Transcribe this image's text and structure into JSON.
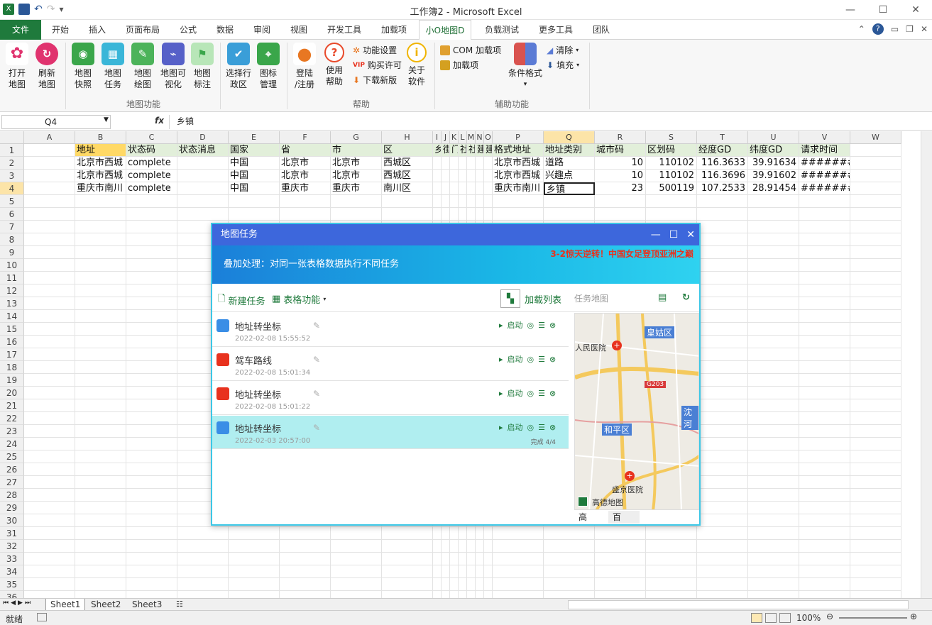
{
  "window": {
    "title": "工作簿2 - Microsoft Excel"
  },
  "ribbon_tabs": [
    {
      "label": "文件"
    },
    {
      "label": "开始"
    },
    {
      "label": "插入"
    },
    {
      "label": "页面布局"
    },
    {
      "label": "公式"
    },
    {
      "label": "数据"
    },
    {
      "label": "审阅"
    },
    {
      "label": "视图"
    },
    {
      "label": "开发工具"
    },
    {
      "label": "加载项"
    },
    {
      "label": "小O地图D"
    },
    {
      "label": "负载测试"
    },
    {
      "label": "更多工具"
    },
    {
      "label": "团队"
    }
  ],
  "ribbon": {
    "map_group": {
      "buttons": [
        {
          "label": "打开\n地图"
        },
        {
          "label": "刷新\n地图"
        },
        {
          "label": "地图\n快照"
        },
        {
          "label": "地图\n任务"
        },
        {
          "label": "地图\n绘图"
        },
        {
          "label": "地图可\n视化"
        },
        {
          "label": "地图\n标注"
        },
        {
          "label": "选择行\n政区"
        },
        {
          "label": "图标\n管理"
        }
      ],
      "name": "地图功能"
    },
    "help_group": {
      "buttons": [
        {
          "label": "登陆\n/注册"
        },
        {
          "label": "使用\n帮助"
        },
        {
          "label": "关于\n软件"
        }
      ],
      "small": [
        {
          "label": "功能设置"
        },
        {
          "label": "购买许可"
        },
        {
          "label": "下载新版"
        }
      ],
      "vip": "VIP",
      "name": "帮助"
    },
    "aux_group": {
      "com": "COM 加载项",
      "addin": "加载项",
      "cond": "条件格式",
      "clear": "清除",
      "fill": "填充",
      "name": "辅助功能"
    }
  },
  "formula_bar": {
    "name_box": "Q4",
    "fx": "fx",
    "value": "乡镇"
  },
  "columns": [
    "A",
    "B",
    "C",
    "D",
    "E",
    "F",
    "G",
    "H",
    "I",
    "J",
    "K",
    "L",
    "M",
    "N",
    "O",
    "P",
    "Q",
    "R",
    "S",
    "T",
    "U",
    "V",
    "W"
  ],
  "rows": [
    "1",
    "2",
    "3",
    "4",
    "5",
    "6",
    "7",
    "8",
    "9",
    "10",
    "11",
    "12",
    "13",
    "14",
    "15",
    "16",
    "17",
    "18",
    "19",
    "20",
    "21",
    "22",
    "23",
    "24",
    "25",
    "26",
    "27",
    "28",
    "29",
    "30",
    "31",
    "32",
    "33",
    "34",
    "35",
    "36"
  ],
  "cells": {
    "r1": {
      "B": "地址",
      "C": "状态码",
      "D": "状态消息",
      "E": "国家",
      "F": "省",
      "G": "市",
      "H": "区",
      "I": "乡",
      "J": "街",
      "K": "门",
      "L": "社",
      "M": "社",
      "N": "建",
      "O": "建",
      "P": "格式地址",
      "Q": "地址类别",
      "R": "城市码",
      "S": "区划码",
      "T": "经度GD",
      "U": "纬度GD",
      "V": "请求时间"
    },
    "r2": {
      "B": "北京市西城",
      "C": "complete",
      "E": "中国",
      "F": "北京市",
      "G": "北京市",
      "H": "西城区",
      "P": "北京市西城",
      "Q": "道路",
      "R": "10",
      "S": "110102",
      "T": "116.3633",
      "U": "39.91634",
      "V": "########"
    },
    "r3": {
      "B": "北京市西城",
      "C": "complete",
      "E": "中国",
      "F": "北京市",
      "G": "北京市",
      "H": "西城区",
      "P": "北京市西城",
      "Q": "兴趣点",
      "R": "10",
      "S": "110102",
      "T": "116.3696",
      "U": "39.91602",
      "V": "########"
    },
    "r4": {
      "B": "重庆市南川",
      "C": "complete",
      "E": "中国",
      "F": "重庆市",
      "G": "重庆市",
      "H": "南川区",
      "P": "重庆市南川",
      "Q": "乡镇",
      "R": "23",
      "S": "500119",
      "T": "107.2533",
      "U": "28.91454",
      "V": "########"
    }
  },
  "sheets": [
    {
      "label": "Sheet1"
    },
    {
      "label": "Sheet2"
    },
    {
      "label": "Sheet3"
    }
  ],
  "status": {
    "ready": "就绪",
    "zoom": "100%"
  },
  "dialog": {
    "title": "地图任务",
    "banner_text": "叠加处理：对同一张表格数据执行不同任务",
    "banner_news": "3-2惊天逆转！中国女足登顶亚洲之巅",
    "new_task": "新建任务",
    "table_func": "表格功能",
    "load_list": "加载列表",
    "task_map": "任务地图",
    "tasks": [
      {
        "name": "地址转坐标",
        "time": "2022-02-08 15:55:52",
        "start": "启动",
        "done": ""
      },
      {
        "name": "驾车路线",
        "time": "2022-02-08 15:01:34",
        "start": "启动",
        "done": ""
      },
      {
        "name": "地址转坐标",
        "time": "2022-02-08 15:01:22",
        "start": "启动",
        "done": ""
      },
      {
        "name": "地址转坐标",
        "time": "2022-02-03 20:57:00",
        "start": "启动",
        "done": "完成 4/4"
      }
    ],
    "map": {
      "labels": [
        {
          "text": "皇姑区"
        },
        {
          "text": "人民医院"
        },
        {
          "text": "G203"
        },
        {
          "text": "沈河"
        },
        {
          "text": "和平区"
        },
        {
          "text": "盛京医院"
        }
      ],
      "provider": "高德地图",
      "tab_gao": "高",
      "tab_bai": "百"
    }
  }
}
